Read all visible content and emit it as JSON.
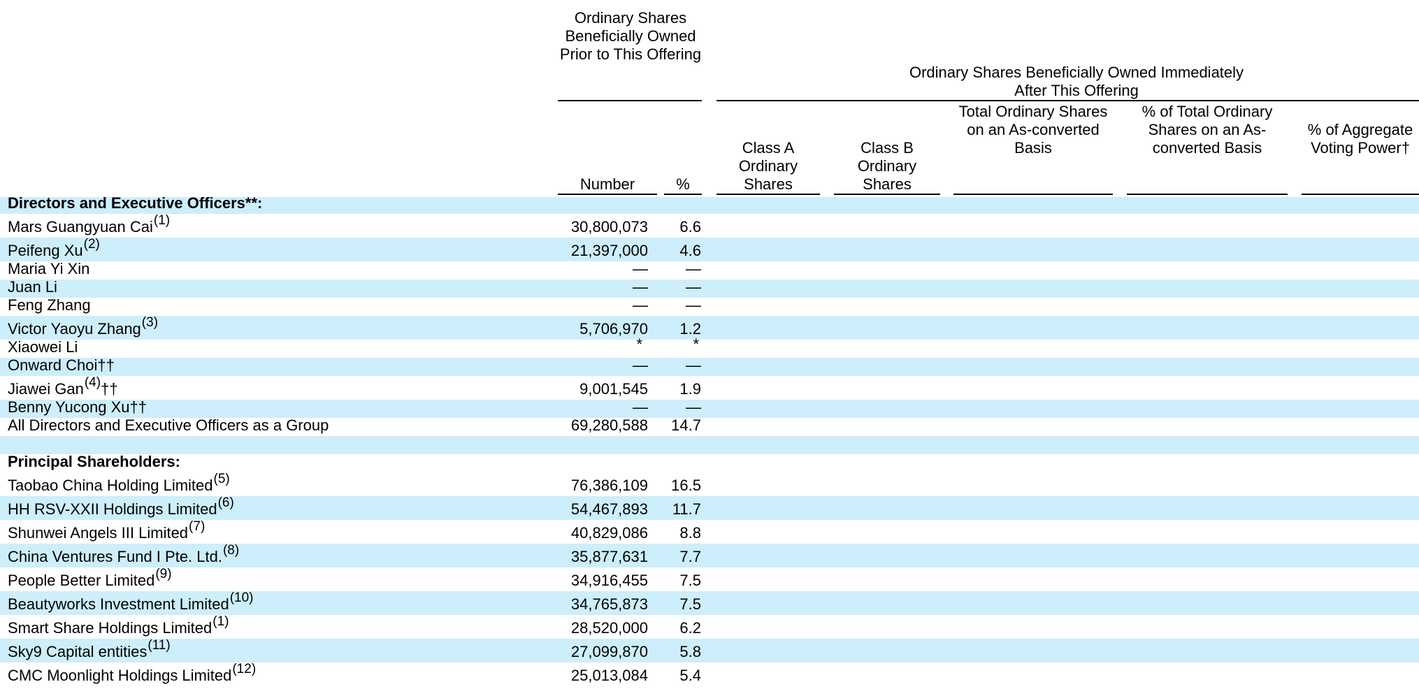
{
  "headers": {
    "prior_group": "Ordinary Shares Beneficially Owned Prior to This Offering",
    "after_group": "Ordinary Shares Beneficially Owned Immediately After This Offering",
    "number": "Number",
    "percent": "%",
    "class_a": "Class A Ordinary Shares",
    "class_b": "Class B Ordinary Shares",
    "total_converted": "Total Ordinary Shares on an As-converted Basis",
    "pct_total_converted": "% of Total Ordinary Shares on an As-converted Basis",
    "pct_voting": "% of Aggregate Voting Power†"
  },
  "rows": [
    {
      "label": "Directors and Executive Officers**:",
      "section": true
    },
    {
      "label": "Mars Guangyuan Cai",
      "note": "(1)",
      "number": "30,800,073",
      "percent": "6.6"
    },
    {
      "label": "Peifeng Xu",
      "note": "(2)",
      "number": "21,397,000",
      "percent": "4.6"
    },
    {
      "label": "Maria Yi Xin",
      "number": "—",
      "percent": "—"
    },
    {
      "label": "Juan Li",
      "number": "—",
      "percent": "—"
    },
    {
      "label": "Feng Zhang",
      "number": "—",
      "percent": "—"
    },
    {
      "label": "Victor Yaoyu Zhang",
      "note": "(3)",
      "number": "5,706,970",
      "percent": "1.2"
    },
    {
      "label": "Xiaowei Li",
      "number": "*",
      "percent": "*"
    },
    {
      "label": "Onward Choi††",
      "number": "—",
      "percent": "—"
    },
    {
      "label": "Jiawei Gan",
      "note": "(4)",
      "suffix": "††",
      "number": "9,001,545",
      "percent": "1.9"
    },
    {
      "label": "Benny Yucong Xu††",
      "number": "—",
      "percent": "—"
    },
    {
      "label": "All Directors and Executive Officers as a Group",
      "number": "69,280,588",
      "percent": "14.7"
    },
    {
      "label": "",
      "spacer": true
    },
    {
      "label": "Principal Shareholders:",
      "section": true
    },
    {
      "label": "Taobao China Holding Limited",
      "note": "(5)",
      "number": "76,386,109",
      "percent": "16.5"
    },
    {
      "label": "HH RSV-XXII Holdings Limited",
      "note": "(6)",
      "number": "54,467,893",
      "percent": "11.7"
    },
    {
      "label": "Shunwei Angels III Limited",
      "note": "(7)",
      "number": "40,829,086",
      "percent": "8.8"
    },
    {
      "label": "China Ventures Fund I Pte. Ltd.",
      "note": "(8)",
      "number": "35,877,631",
      "percent": "7.7"
    },
    {
      "label": "People Better Limited",
      "note": "(9)",
      "number": "34,916,455",
      "percent": "7.5"
    },
    {
      "label": "Beautyworks Investment Limited",
      "note": "(10)",
      "number": "34,765,873",
      "percent": "7.5"
    },
    {
      "label": "Smart Share Holdings Limited",
      "note": "(1)",
      "number": "28,520,000",
      "percent": "6.2"
    },
    {
      "label": "Sky9 Capital entities",
      "note": "(11)",
      "number": "27,099,870",
      "percent": "5.8"
    },
    {
      "label": "CMC Moonlight Holdings Limited",
      "note": "(12)",
      "number": "25,013,084",
      "percent": "5.4"
    }
  ]
}
